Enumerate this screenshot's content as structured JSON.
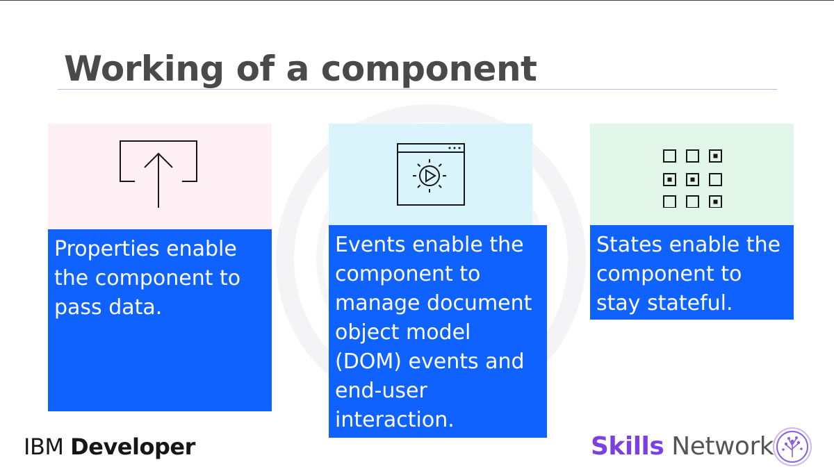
{
  "slide": {
    "title": "Working of a component"
  },
  "cards": [
    {
      "icon": "upload-icon",
      "text": "Properties enable the component to pass data.",
      "background": "#fdeff4"
    },
    {
      "icon": "browser-play-icon",
      "text": "Events enable the component to manage document object model (DOM) events and end-user interaction.",
      "background": "#d9f5fb"
    },
    {
      "icon": "grid-state-icon",
      "text": "States enable the component to stay stateful.",
      "background": "#e3f6ea"
    }
  ],
  "footer": {
    "ibm_light": "IBM",
    "ibm_bold": "Developer",
    "skills_bold": "Skills",
    "skills_light": "Network",
    "logo_icon": "skills-network-tree-icon"
  },
  "colors": {
    "accent_blue": "#0f62fe",
    "title_gray": "#4a4a4a",
    "skills_purple": "#7c3fe0"
  }
}
